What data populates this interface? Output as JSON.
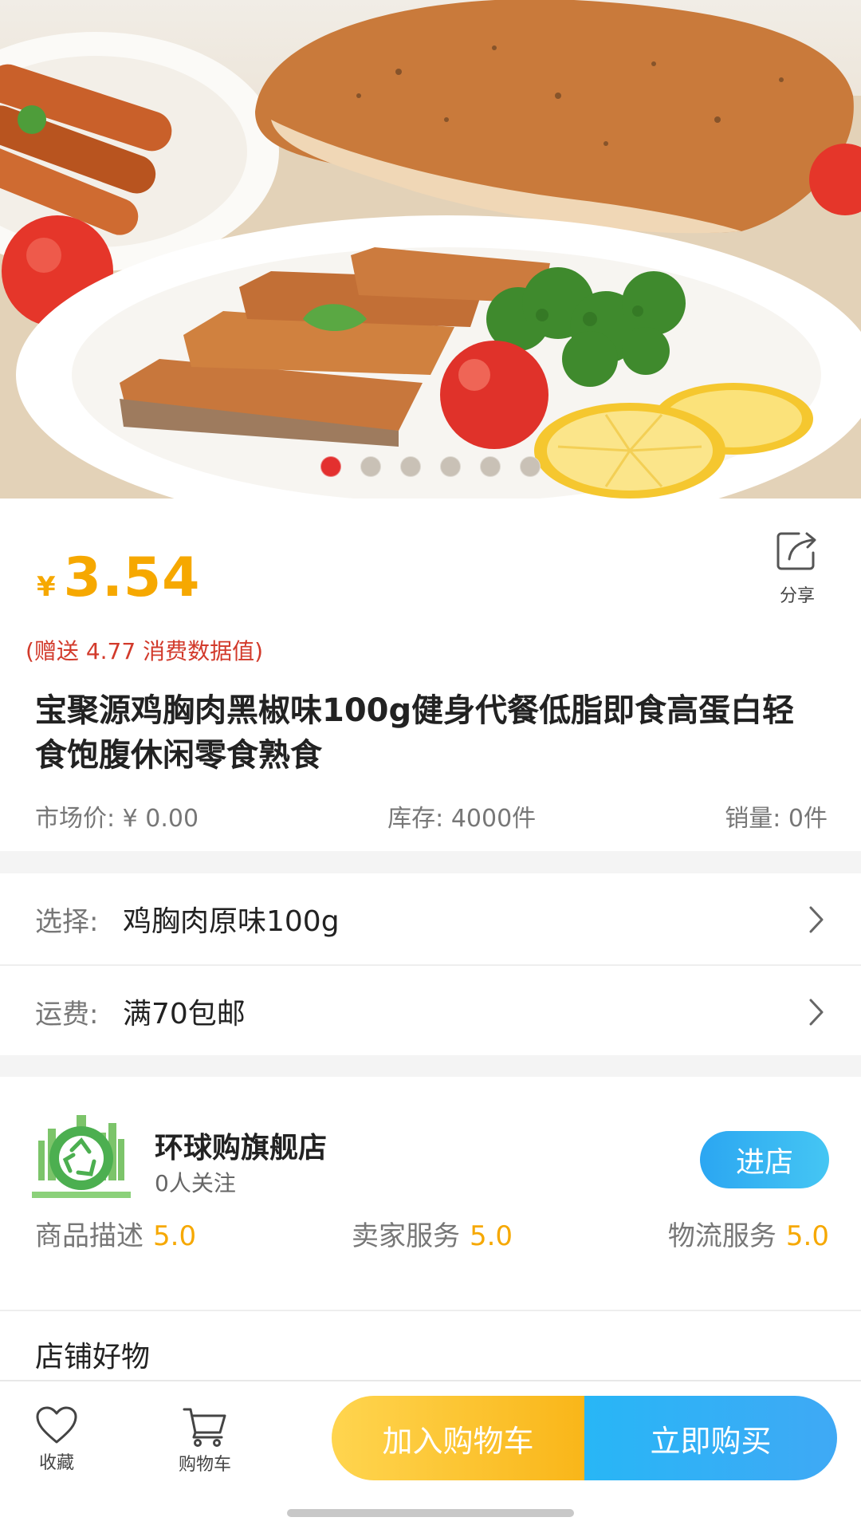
{
  "product": {
    "price_currency": "¥",
    "price": "3.54",
    "share_label": "分享",
    "gift_note": "(赠送 4.77 消费数据值)",
    "title": "宝聚源鸡胸肉黑椒味100g健身代餐低脂即食高蛋白轻食饱腹休闲零食熟食",
    "market_price": "市场价: ¥ 0.00",
    "stock": "库存: 4000件",
    "sales": "销量: 0件"
  },
  "carousel": {
    "count": 6,
    "active_index": 0
  },
  "options": {
    "select_label": "选择:",
    "select_value": "鸡胸肉原味100g",
    "shipping_label": "运费:",
    "shipping_value": "满70包邮"
  },
  "shop": {
    "name": "环球购旗舰店",
    "followers": "0人关注",
    "enter_label": "进店",
    "ratings": [
      {
        "label": "商品描述",
        "score": "5.0"
      },
      {
        "label": "卖家服务",
        "score": "5.0"
      },
      {
        "label": "物流服务",
        "score": "5.0"
      }
    ],
    "goods_title": "店铺好物"
  },
  "bottom_bar": {
    "favorite_label": "收藏",
    "cart_label": "购物车",
    "add_to_cart": "加入购物车",
    "buy_now": "立即购买"
  },
  "colors": {
    "price": "#f6a800",
    "gift": "#d23a2b",
    "accent_blue": "#2ba6f2",
    "cart_yellow": "#f9b619",
    "carousel_active": "#e3302f"
  },
  "icons": [
    "share-icon",
    "chevron-right-icon",
    "heart-icon",
    "cart-icon",
    "recycle-logo-icon"
  ]
}
